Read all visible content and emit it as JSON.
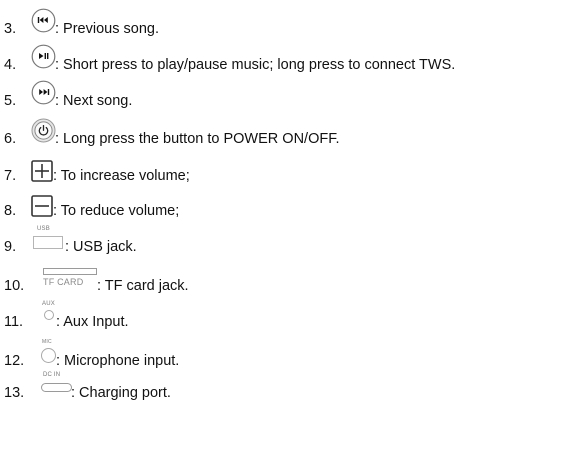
{
  "items": [
    {
      "number": "3.",
      "description": ": Previous song.",
      "icon": "previous-track-icon"
    },
    {
      "number": "4.",
      "description": ": Short press to play/pause music; long press to connect TWS.",
      "icon": "play-pause-icon"
    },
    {
      "number": "5.",
      "description": ": Next song.",
      "icon": "next-track-icon"
    },
    {
      "number": "6.",
      "description": ": Long press the button to POWER ON/OFF.",
      "icon": "power-button-icon"
    },
    {
      "number": "7.",
      "description": ": To increase volume;",
      "icon": "plus-button-icon"
    },
    {
      "number": "8.",
      "description": ": To reduce volume;",
      "icon": "minus-button-icon"
    },
    {
      "number": "9.",
      "description": ": USB jack.",
      "icon": "usb-jack-icon",
      "icon_label": "USB"
    },
    {
      "number": "10.",
      "description": " : TF card jack.",
      "icon": "tf-card-slot-icon",
      "icon_label": "TF CARD"
    },
    {
      "number": "11.",
      "description": " : Aux Input.",
      "icon": "aux-jack-icon",
      "icon_label": "AUX"
    },
    {
      "number": "12.",
      "description": ": Microphone input.",
      "icon": "microphone-jack-icon",
      "icon_label": "MIC"
    },
    {
      "number": "13.",
      "description": ": Charging port.",
      "icon": "dc-in-port-icon",
      "icon_label": "DC IN"
    }
  ]
}
